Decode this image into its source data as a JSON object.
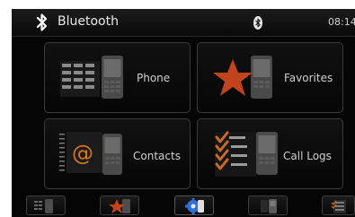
{
  "header": {
    "title": "Bluetooth",
    "time": "08:14",
    "logo_icon": "bluetooth-logo-icon",
    "status_icon": "bluetooth-status-icon"
  },
  "menu": {
    "tiles": [
      {
        "label": "Phone",
        "icon": "phone-keypad-icon"
      },
      {
        "label": "Favorites",
        "icon": "favorites-star-icon"
      },
      {
        "label": "Contacts",
        "icon": "contacts-at-icon"
      },
      {
        "label": "Call Logs",
        "icon": "call-logs-checklist-icon"
      }
    ]
  },
  "dock": {
    "items": [
      {
        "icon": "phone-keypad-icon"
      },
      {
        "icon": "favorites-star-icon"
      },
      {
        "icon": "settings-gear-icon"
      },
      {
        "icon": "phone-device-icon"
      },
      {
        "icon": "call-logs-icon"
      }
    ]
  },
  "colors": {
    "star": "#c2441c",
    "at": "#d9761e",
    "check": "#c96a2a",
    "bluetooth": "#ffffff",
    "gear": "#2f6fd6"
  }
}
